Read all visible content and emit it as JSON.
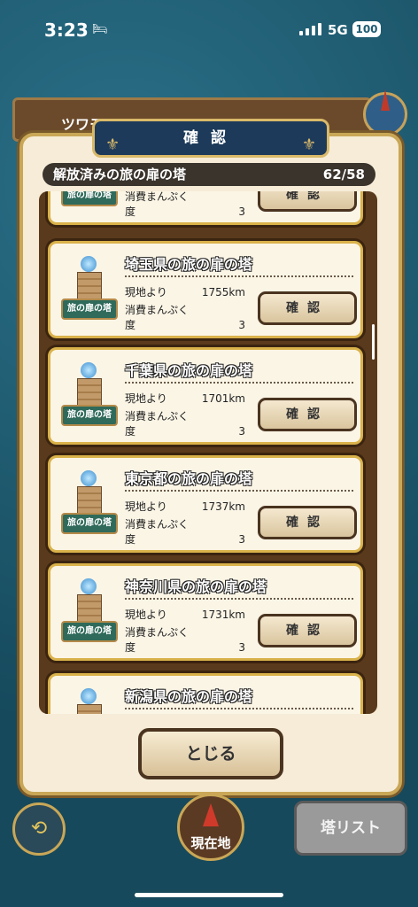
{
  "status": {
    "time": "3:23",
    "network": "5G",
    "battery": "100"
  },
  "background": {
    "topbar_label": "ツワモ",
    "back_icon": "back-arrow-icon"
  },
  "dialog": {
    "title": "確認",
    "header_label": "解放済みの旅の扉の塔",
    "count": "62/58",
    "from_label": "現地より",
    "cost_label": "消費まんぷく度",
    "confirm_label": "確認",
    "tower_sign": "旅の扉の塔",
    "items": [
      {
        "name": "",
        "distance": "",
        "cost": "3"
      },
      {
        "name": "埼玉県の旅の扉の塔",
        "distance": "1755km",
        "cost": "3"
      },
      {
        "name": "千葉県の旅の扉の塔",
        "distance": "1701km",
        "cost": "3"
      },
      {
        "name": "東京都の旅の扉の塔",
        "distance": "1737km",
        "cost": "3"
      },
      {
        "name": "神奈川県の旅の扉の塔",
        "distance": "1731km",
        "cost": "3"
      },
      {
        "name": "新潟県の旅の扉の塔",
        "distance": "",
        "cost": ""
      }
    ],
    "close_label": "とじる"
  },
  "bottom": {
    "current_location": "現在地",
    "tower_list": "塔リスト"
  }
}
